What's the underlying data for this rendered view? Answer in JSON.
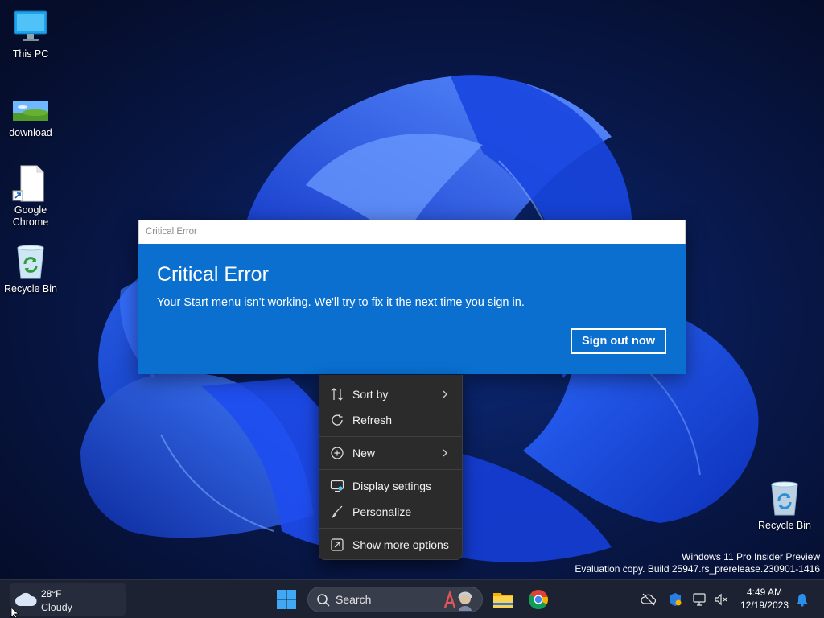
{
  "desktop": {
    "icons": [
      {
        "label": "This PC",
        "icon": "monitor-icon"
      },
      {
        "label": "download",
        "icon": "image-file-icon"
      },
      {
        "label": "Google Chrome",
        "icon": "shortcut-file-icon"
      },
      {
        "label": "Recycle Bin",
        "icon": "recycle-bin-icon"
      }
    ],
    "right_icon": {
      "label": "Recycle Bin",
      "icon": "recycle-bin-icon"
    }
  },
  "dialog": {
    "window_title": "Critical Error",
    "heading": "Critical Error",
    "message": "Your Start menu isn't working. We'll try to fix it the next time you sign in.",
    "button_label": "Sign out now",
    "accent_color": "#0a6fcf"
  },
  "context_menu": {
    "items": [
      {
        "label": "Sort by",
        "icon": "sort-icon",
        "has_submenu": true
      },
      {
        "label": "Refresh",
        "icon": "refresh-icon",
        "has_submenu": false
      },
      {
        "label": "New",
        "icon": "plus-circle-icon",
        "has_submenu": true
      },
      {
        "label": "Display settings",
        "icon": "display-icon",
        "has_submenu": false
      },
      {
        "label": "Personalize",
        "icon": "brush-icon",
        "has_submenu": false
      },
      {
        "label": "Show more options",
        "icon": "share-icon",
        "has_submenu": false
      }
    ]
  },
  "watermark": {
    "line1": "Windows 11 Pro Insider Preview",
    "line2": "Evaluation copy. Build 25947.rs_prerelease.230901-1416"
  },
  "taskbar": {
    "weather": {
      "temp": "28°F",
      "condition": "Cloudy",
      "icon": "cloud-icon"
    },
    "search_label": "Search",
    "pinned": [
      "windows-start-icon",
      "file-explorer-icon",
      "chrome-icon"
    ],
    "tray": [
      "cloud-off-icon",
      "security-shield-icon",
      "network-icon",
      "volume-muted-icon",
      "notification-bell-icon"
    ],
    "clock": {
      "time": "4:49 AM",
      "date": "12/19/2023"
    }
  }
}
